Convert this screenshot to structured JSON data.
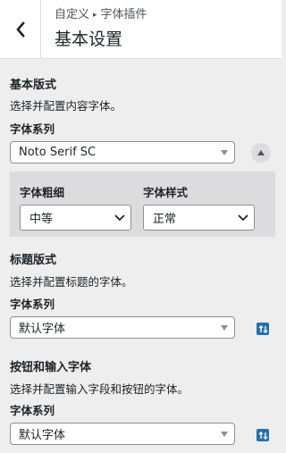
{
  "header": {
    "back_icon": "chevron-left-icon",
    "breadcrumb_root": "自定义",
    "breadcrumb_arrow": "▸",
    "breadcrumb_current": "字体插件",
    "title": "基本设置"
  },
  "basic": {
    "title": "基本版式",
    "description": "选择并配置内容字体。",
    "family_label": "字体系列",
    "family_value": "Noto Serif SC",
    "weight_label": "字体粗细",
    "weight_value": "中等",
    "style_label": "字体样式",
    "style_value": "正常"
  },
  "headings": {
    "title": "标题版式",
    "description": "选择并配置标题的字体。",
    "family_label": "字体系列",
    "family_value": "默认字体"
  },
  "buttons": {
    "title": "按钮和输入字体",
    "description": "选择并配置输入字段和按钮的字体。",
    "family_label": "字体系列",
    "family_value": "默认字体"
  },
  "colors": {
    "accent": "#2271b1",
    "panel": "#dcdcde",
    "background": "#eeeeee"
  }
}
